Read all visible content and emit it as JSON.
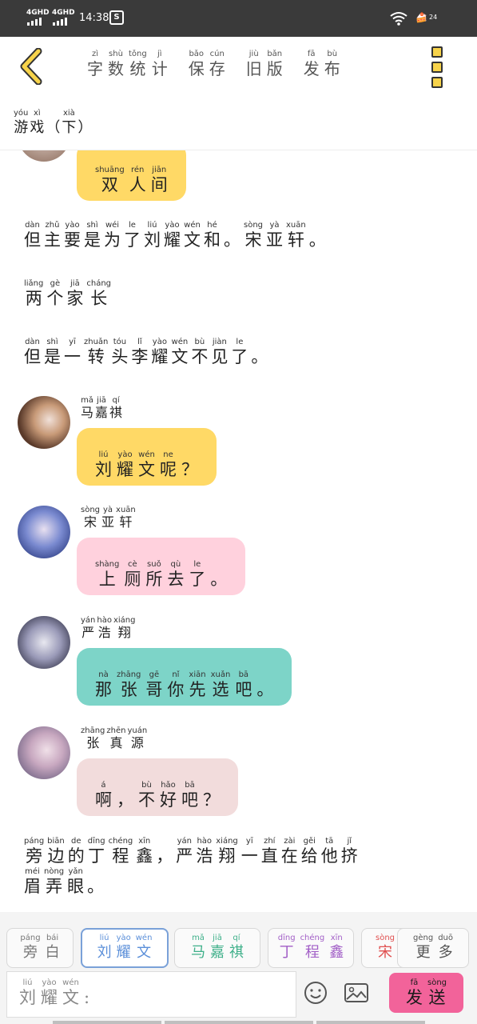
{
  "status_bar": {
    "signal1": "4GHD",
    "signal2": "4GHD",
    "time": "14:38",
    "app_badge": "S",
    "battery": "24"
  },
  "toolbar": {
    "back_icon": "chevron-left-icon",
    "menu_icon": "vertical-squares-icon",
    "tabs": [
      {
        "name": "word-count",
        "chars": [
          "字",
          "数",
          "统",
          "计"
        ],
        "pinyin": [
          "zì",
          "shù",
          "tǒng",
          "jì"
        ]
      },
      {
        "name": "save",
        "chars": [
          "保",
          "存"
        ],
        "pinyin": [
          "bǎo",
          "cún"
        ]
      },
      {
        "name": "old-version",
        "chars": [
          "旧",
          "版"
        ],
        "pinyin": [
          "jiù",
          "bǎn"
        ]
      },
      {
        "name": "publish",
        "chars": [
          "发",
          "布"
        ],
        "pinyin": [
          "fā",
          "bù"
        ]
      }
    ]
  },
  "subtitle": {
    "chars": [
      "游",
      "戏",
      "（",
      "下",
      "）"
    ],
    "pinyin": [
      "yóu",
      "xì",
      "",
      "xià",
      ""
    ]
  },
  "colors": {
    "yellow": "#ffd966",
    "pink": "#ffd1dd",
    "teal": "#7dd4c8",
    "rose": "#f2dcdc",
    "send": "#f2639a",
    "accent": "#f7d34a"
  },
  "messages": [
    {
      "type": "bubble",
      "name": "top-partial",
      "color": "#ffd966",
      "chars": [
        "双",
        "人",
        "间"
      ],
      "pinyin": [
        "shuāng",
        "rén",
        "jiān"
      ]
    },
    {
      "type": "narration",
      "chars": [
        "但",
        "主",
        "要",
        "是",
        "为",
        "了",
        "刘",
        "耀",
        "文",
        "和",
        "。",
        "宋",
        "亚",
        "轩",
        "。"
      ],
      "pinyin": [
        "dàn",
        "zhǔ",
        "yào",
        "shì",
        "wéi",
        "le",
        "liú",
        "yào",
        "wén",
        "hé",
        "",
        "sòng",
        "yà",
        "xuān",
        ""
      ]
    },
    {
      "type": "narration",
      "chars": [
        "两",
        "个",
        "家",
        "长"
      ],
      "pinyin": [
        "liǎng",
        "gè",
        "jiā",
        "cháng"
      ]
    },
    {
      "type": "narration",
      "chars": [
        "但",
        "是",
        "一",
        "转",
        "头",
        "李",
        "耀",
        "文",
        "不",
        "见",
        "了",
        "。"
      ],
      "pinyin": [
        "dàn",
        "shì",
        "yī",
        "zhuǎn",
        "tóu",
        "lǐ",
        "yào",
        "wén",
        "bù",
        "jiàn",
        "le",
        ""
      ]
    },
    {
      "type": "bubble",
      "name": "ma-jiaqi",
      "sender_chars": [
        "马",
        "嘉",
        "祺"
      ],
      "sender_pinyin": [
        "mǎ",
        "jiā",
        "qí"
      ],
      "color": "#ffd966",
      "chars": [
        "刘",
        "耀",
        "文",
        "呢",
        "？"
      ],
      "pinyin": [
        "liú",
        "yào",
        "wén",
        "ne",
        ""
      ]
    },
    {
      "type": "bubble",
      "name": "song-yaxuan",
      "sender_chars": [
        "宋",
        "亚",
        "轩"
      ],
      "sender_pinyin": [
        "sòng",
        "yà",
        "xuān"
      ],
      "color": "#ffd1dd",
      "chars": [
        "上",
        "厕",
        "所",
        "去",
        "了",
        "。"
      ],
      "pinyin": [
        "shàng",
        "cè",
        "suǒ",
        "qù",
        "le",
        ""
      ]
    },
    {
      "type": "bubble",
      "name": "yan-haoxiang",
      "sender_chars": [
        "严",
        "浩",
        "翔"
      ],
      "sender_pinyin": [
        "yán",
        "hào",
        "xiáng"
      ],
      "color": "#7dd4c8",
      "chars": [
        "那",
        "张",
        "哥",
        "你",
        "先",
        "选",
        "吧",
        "。"
      ],
      "pinyin": [
        "nà",
        "zhāng",
        "gē",
        "nǐ",
        "xiān",
        "xuǎn",
        "bā",
        ""
      ]
    },
    {
      "type": "bubble",
      "name": "zhang-zhenyuan",
      "sender_chars": [
        "张",
        "真",
        "源"
      ],
      "sender_pinyin": [
        "zhāng",
        "zhēn",
        "yuán"
      ],
      "color": "#f2dcdc",
      "chars": [
        "啊",
        "，",
        "不",
        "好",
        "吧",
        "？"
      ],
      "pinyin": [
        "á",
        "",
        "bù",
        "hǎo",
        "bā",
        ""
      ]
    },
    {
      "type": "narration",
      "chars": [
        "旁",
        "边",
        "的",
        "丁",
        "程",
        "鑫",
        "，",
        "严",
        "浩",
        "翔",
        "一",
        "直",
        "在",
        "给",
        "他",
        "挤"
      ],
      "pinyin": [
        "páng",
        "biān",
        "de",
        "dīng",
        "chéng",
        "xīn",
        "",
        "yán",
        "hào",
        "xiáng",
        "yī",
        "zhí",
        "zài",
        "gěi",
        "tā",
        "jǐ"
      ]
    },
    {
      "type": "narration",
      "chars": [
        "眉",
        "弄",
        "眼",
        "。"
      ],
      "pinyin": [
        "méi",
        "nòng",
        "yǎn",
        ""
      ]
    }
  ],
  "chips": [
    {
      "name": "narrator",
      "chars": [
        "旁",
        "白"
      ],
      "pinyin": [
        "páng",
        "bái"
      ],
      "color": "#777777"
    },
    {
      "name": "liu-yaowen",
      "chars": [
        "刘",
        "耀",
        "文"
      ],
      "pinyin": [
        "liú",
        "yào",
        "wén"
      ],
      "color": "#5b8fd9"
    },
    {
      "name": "ma-jiaqi",
      "chars": [
        "马",
        "嘉",
        "祺"
      ],
      "pinyin": [
        "mǎ",
        "jiā",
        "qí"
      ],
      "color": "#3fb08a"
    },
    {
      "name": "ding-chengxin",
      "chars": [
        "丁",
        "程",
        "鑫"
      ],
      "pinyin": [
        "dīng",
        "chéng",
        "xīn"
      ],
      "color": "#a25fc7"
    },
    {
      "name": "song",
      "chars": [
        "宋"
      ],
      "pinyin": [
        "sòng"
      ],
      "color": "#e05050"
    },
    {
      "name": "more",
      "chars": [
        "更",
        "多"
      ],
      "pinyin": [
        "gèng",
        "duō"
      ],
      "color": "#555555"
    }
  ],
  "input": {
    "chars": [
      "刘",
      "耀",
      "文",
      ":"
    ],
    "pinyin": [
      "liú",
      "yào",
      "wén",
      ""
    ]
  },
  "send": {
    "chars": [
      "发",
      "送"
    ],
    "pinyin": [
      "fā",
      "sòng"
    ]
  },
  "icons": {
    "emoji": "smiley-icon",
    "image": "image-icon"
  }
}
